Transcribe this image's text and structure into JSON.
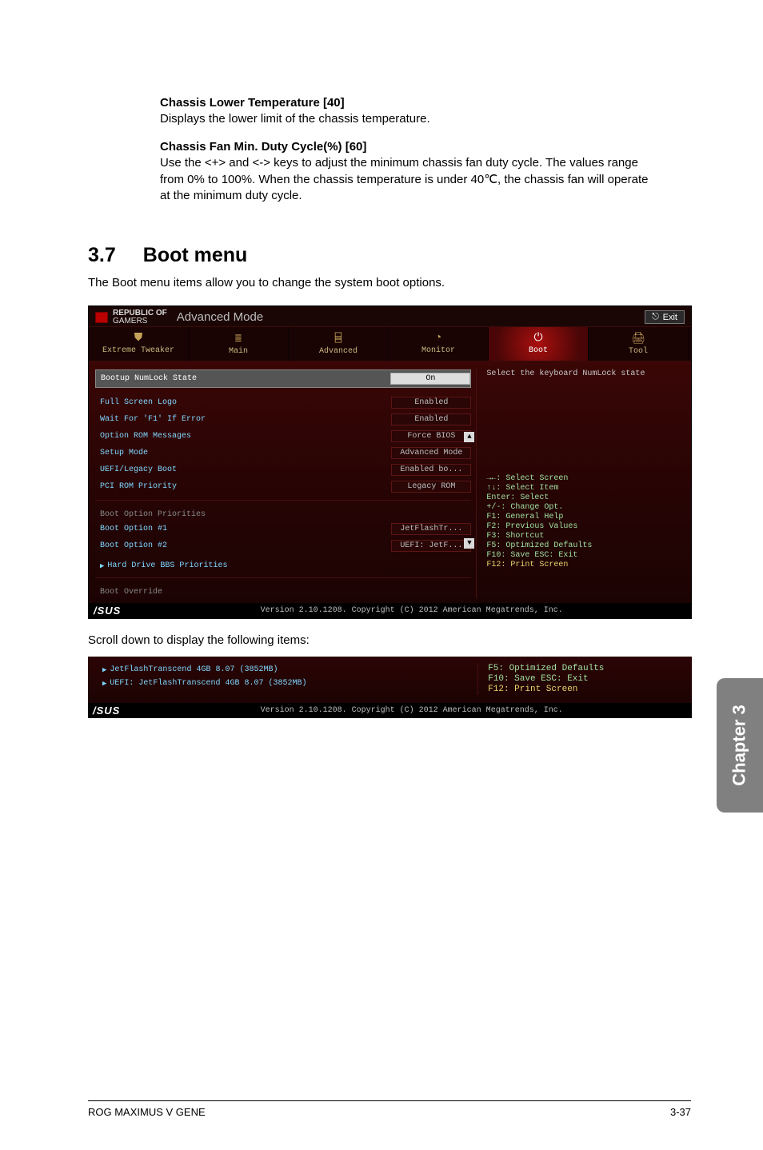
{
  "doc": {
    "section_chassis_lower": "Chassis Lower Temperature [40]",
    "section_chassis_lower_text": "Displays the lower limit of the chassis temperature.",
    "section_fan_min": "Chassis Fan Min. Duty Cycle(%) [60]",
    "section_fan_min_text": "Use the <+> and <-> keys to adjust the minimum chassis fan duty cycle. The values range from 0% to 100%. When the chassis temperature is under 40℃, the chassis fan will operate at the minimum duty cycle.",
    "section_number": "3.7",
    "section_title": "Boot menu",
    "section_subtitle": "The Boot menu items allow you to change the system boot options.",
    "between": "Scroll down to display the following items:",
    "footer_left": "ROG MAXIMUS V GENE",
    "footer_right": "3-37",
    "chapter_tab": "Chapter 3"
  },
  "bios": {
    "brand_line1": "REPUBLIC OF",
    "brand_line2": "GAMERS",
    "mode": "Advanced Mode",
    "exit": "Exit",
    "tabs": [
      {
        "label": "Extreme Tweaker",
        "icon": "⛊"
      },
      {
        "label": "Main",
        "icon": "≣"
      },
      {
        "label": "Advanced",
        "icon": "⌸"
      },
      {
        "label": "Monitor",
        "icon": "◔"
      },
      {
        "label": "Boot",
        "icon": "⏻"
      },
      {
        "label": "Tool",
        "icon": "🖨"
      }
    ],
    "right_desc": "Select the keyboard NumLock state",
    "help": {
      "l1": "→←: Select Screen",
      "l2": "↑↓: Select Item",
      "l3": "Enter: Select",
      "l4": "+/-: Change Opt.",
      "l5": "F1: General Help",
      "l6": "F2: Previous Values",
      "l7": "F3: Shortcut",
      "l8": "F5: Optimized Defaults",
      "l9": "F10: Save  ESC: Exit",
      "l10": "F12: Print Screen"
    },
    "fields": {
      "numlock_label": "Bootup NumLock State",
      "numlock_value": "On",
      "fullscreen_label": "Full Screen Logo",
      "fullscreen_value": "Enabled",
      "wait_label": "Wait For 'F1' If Error",
      "wait_value": "Enabled",
      "optrom_label": "Option ROM Messages",
      "optrom_value": "Force BIOS",
      "setup_label": "Setup Mode",
      "setup_value": "Advanced Mode",
      "uefi_label": "UEFI/Legacy Boot",
      "uefi_value": "Enabled bo...",
      "pcirom_label": "PCI ROM Priority",
      "pcirom_value": "Legacy ROM",
      "priorities_title": "Boot Option Priorities",
      "opt1_label": "Boot Option #1",
      "opt1_value": "JetFlashTr...",
      "opt2_label": "Boot Option #2",
      "opt2_value": "UEFI: JetF...",
      "hdd_link": "Hard Drive BBS Priorities",
      "override_title": "Boot Override"
    },
    "copyright": "Version 2.10.1208. Copyright (C) 2012 American Megatrends, Inc.",
    "asus": "/SUS"
  },
  "bios_small": {
    "item1": "JetFlashTranscend 4GB 8.07  (3852MB)",
    "item2": "UEFI: JetFlashTranscend 4GB 8.07 (3852MB)",
    "help_f5": "F5: Optimized Defaults",
    "help_f10": "F10: Save  ESC: Exit",
    "help_f12": "F12: Print Screen"
  }
}
